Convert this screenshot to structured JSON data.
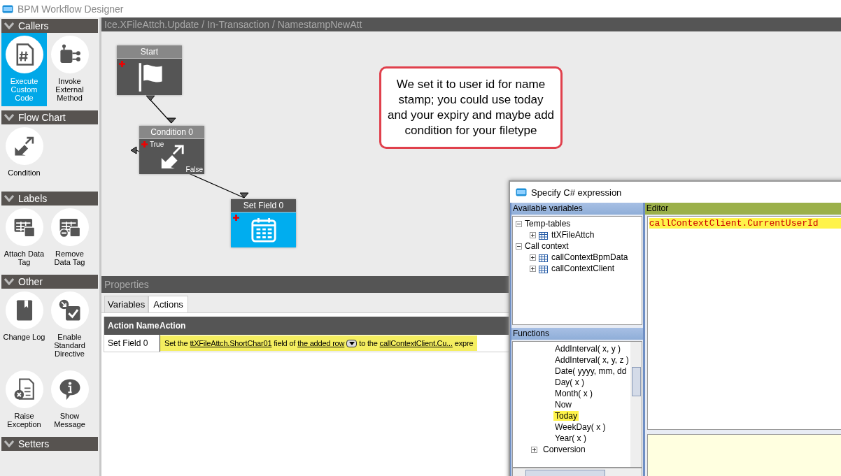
{
  "window": {
    "title": "BPM Workflow Designer"
  },
  "sidebar": {
    "sections": [
      {
        "title": "Callers",
        "tools": [
          {
            "label": "Execute Custom Code",
            "kind": "code",
            "selected": true
          },
          {
            "label": "Invoke External Method",
            "kind": "external",
            "selected": false
          }
        ]
      },
      {
        "title": "Flow Chart",
        "tools": [
          {
            "label": "Condition",
            "kind": "condition",
            "selected": false
          }
        ]
      },
      {
        "title": "Labels",
        "tools": [
          {
            "label": "Attach Data Tag",
            "kind": "attach",
            "selected": false
          },
          {
            "label": "Remove Data Tag",
            "kind": "remove",
            "selected": false
          }
        ]
      },
      {
        "title": "Other",
        "tools": [
          {
            "label": "Change Log",
            "kind": "log",
            "selected": false
          },
          {
            "label": "Enable Standard Directive",
            "kind": "directive",
            "selected": false
          },
          {
            "label": "Raise Exception",
            "kind": "exception",
            "selected": false
          },
          {
            "label": "Show Message",
            "kind": "message",
            "selected": false
          }
        ]
      },
      {
        "title": "Setters"
      }
    ]
  },
  "breadcrumb": "Ice.XFileAttch.Update / In-Transaction / NamestampNewAtt",
  "canvas": {
    "nodes": [
      {
        "title": "Start",
        "kind": "start"
      },
      {
        "title": "Condition 0",
        "kind": "condition",
        "true_label": "True",
        "false_label": "False"
      },
      {
        "title": "Set Field 0",
        "kind": "setfield"
      }
    ],
    "callout": "We set it to user id for name stamp; you could use today and your expiry and maybe add condition for your filetype"
  },
  "properties": {
    "title": "Properties",
    "tabs": [
      {
        "label": "Variables",
        "selected": false
      },
      {
        "label": "Actions",
        "selected": true
      }
    ],
    "columns": [
      "Action Name",
      "Action"
    ],
    "rows": [
      {
        "name": "Set Field 0",
        "parts": [
          {
            "kind": "text",
            "text": "Set the"
          },
          {
            "kind": "link",
            "text": "ttXFileAttch.ShortChar01"
          },
          {
            "kind": "text",
            "text": "field of"
          },
          {
            "kind": "link",
            "text": "the added row"
          },
          {
            "kind": "dropdown"
          },
          {
            "kind": "text",
            "text": "to the"
          },
          {
            "kind": "link",
            "text": "callContextClient.Cu..."
          },
          {
            "kind": "text",
            "text": "expre"
          }
        ]
      }
    ]
  },
  "dialog": {
    "title": "Specify C# expression",
    "variables": {
      "title": "Available variables",
      "tree": [
        {
          "label": "Temp-tables",
          "expanded": true,
          "children": [
            {
              "label": "ttXFileAttch",
              "expanded": false
            }
          ]
        },
        {
          "label": "Call context",
          "expanded": true,
          "children": [
            {
              "label": "callContextBpmData",
              "expanded": false
            },
            {
              "label": "callContextClient",
              "expanded": false
            }
          ]
        }
      ]
    },
    "functions": {
      "title": "Functions",
      "items": [
        {
          "label": "AddInterval( x, y )",
          "kind": "function",
          "highlighted": false
        },
        {
          "label": "AddInterval( x, y, z )",
          "kind": "function",
          "highlighted": false
        },
        {
          "label": "Date( yyyy, mm, dd",
          "kind": "function",
          "highlighted": false
        },
        {
          "label": "Day( x )",
          "kind": "function",
          "highlighted": false
        },
        {
          "label": "Month( x )",
          "kind": "function",
          "highlighted": false
        },
        {
          "label": "Now",
          "kind": "function",
          "highlighted": false
        },
        {
          "label": "Today",
          "kind": "function",
          "highlighted": true
        },
        {
          "label": "WeekDay( x )",
          "kind": "function",
          "highlighted": false
        },
        {
          "label": "Year( x )",
          "kind": "function",
          "highlighted": false
        },
        {
          "label": "Conversion",
          "kind": "category",
          "highlighted": false
        }
      ]
    },
    "editor": {
      "title": "Editor",
      "code": "callContextClient.CurrentUserId"
    }
  }
}
